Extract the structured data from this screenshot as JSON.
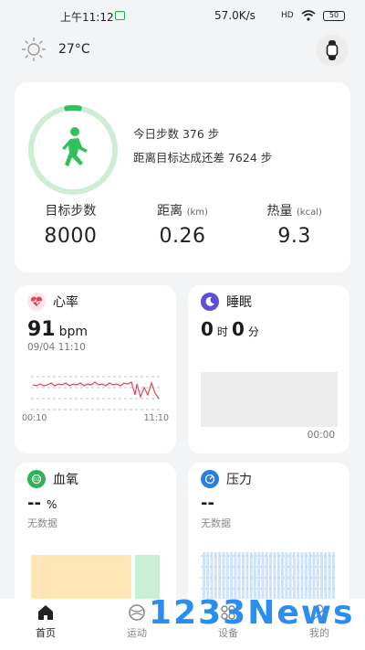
{
  "status_bar": {
    "time": "上午11:12",
    "speed": "57.0K/s",
    "signal": "HD",
    "battery": "50"
  },
  "weather": {
    "icon": "sun-icon",
    "temperature": "27°C"
  },
  "steps": {
    "progress": 0.047,
    "today_line": "今日步数 376 步",
    "remaining_line": "距离目标达成还差 7624 步",
    "stats": [
      {
        "label": "目标步数",
        "unit": "",
        "value": "8000"
      },
      {
        "label": "距离",
        "unit": "(km)",
        "value": "0.26"
      },
      {
        "label": "热量",
        "unit": "(kcal)",
        "value": "9.3"
      }
    ]
  },
  "heart_rate": {
    "title": "心率",
    "value": "91",
    "unit": "bpm",
    "datetime": "09/04 11:10",
    "axis_start": "00:10",
    "axis_end": "11:10",
    "accent": "#e5455a"
  },
  "sleep": {
    "title": "睡眠",
    "hours": "0",
    "hours_unit": "时",
    "minutes": "0",
    "minutes_unit": "分",
    "time_label": "00:00",
    "accent": "#5b4fd6"
  },
  "blood_oxygen": {
    "title": "血氧",
    "value": "--",
    "unit": "%",
    "note": "无数据",
    "accent": "#2fb158"
  },
  "stress": {
    "title": "压力",
    "value": "--",
    "note": "无数据",
    "accent": "#2a7de1"
  },
  "tabs": [
    {
      "label": "首页",
      "icon": "home-icon",
      "active": true
    },
    {
      "label": "运动",
      "icon": "sport-icon",
      "active": false
    },
    {
      "label": "设备",
      "icon": "device-icon",
      "active": false
    },
    {
      "label": "我的",
      "icon": "profile-icon",
      "active": false
    }
  ],
  "watermark": "1233News"
}
